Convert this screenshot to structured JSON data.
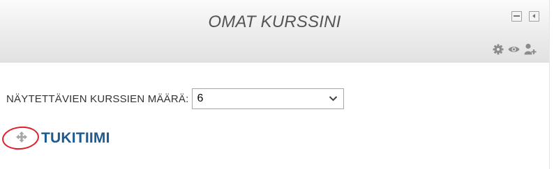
{
  "block": {
    "title": "OMAT KURSSINI",
    "controls": {
      "minimize_icon": "minimize-icon",
      "dock_icon": "dock-icon",
      "settings_icon": "gear-icon",
      "visibility_icon": "eye-icon",
      "assign_roles_icon": "add-user-icon"
    }
  },
  "settings": {
    "courses_to_show_label": "NÄYTETTÄVIEN KURSSIEN MÄÄRÄ:",
    "courses_to_show_value": "6"
  },
  "courses": [
    {
      "name": "TUKITIIMI",
      "move_icon": "move-icon"
    }
  ],
  "colors": {
    "title_text": "#555555",
    "course_link": "#1d5a8f",
    "annotation_circle": "#e0202b"
  }
}
